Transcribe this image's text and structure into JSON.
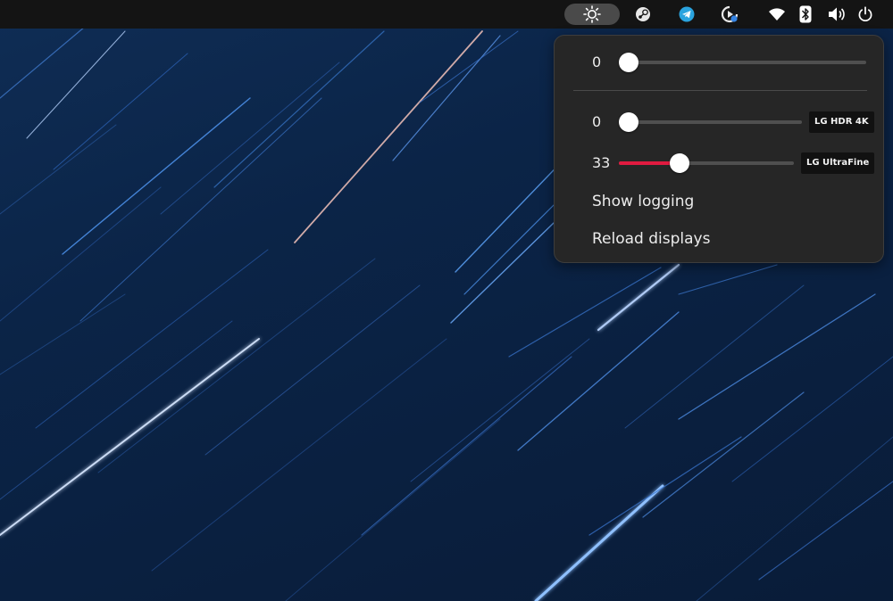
{
  "topbar": {
    "tray_icons": [
      {
        "name": "brightness-icon",
        "active": true
      },
      {
        "name": "steam-icon"
      },
      {
        "name": "telegram-icon"
      },
      {
        "name": "updates-icon"
      },
      {
        "name": "wifi-icon"
      },
      {
        "name": "bluetooth-icon"
      },
      {
        "name": "volume-icon"
      },
      {
        "name": "power-icon"
      }
    ]
  },
  "brightness_menu": {
    "master": {
      "value": "0",
      "level": 0
    },
    "displays": [
      {
        "value": "0",
        "label": "LG HDR 4K",
        "level": 0
      },
      {
        "value": "33",
        "label": "LG UltraFine",
        "level": 0.33
      }
    ],
    "items": [
      "Show logging",
      "Reload displays"
    ]
  },
  "colors": {
    "panel_bg": "#262626",
    "accent": "#e01b40",
    "topbar_bg": "#141414"
  }
}
